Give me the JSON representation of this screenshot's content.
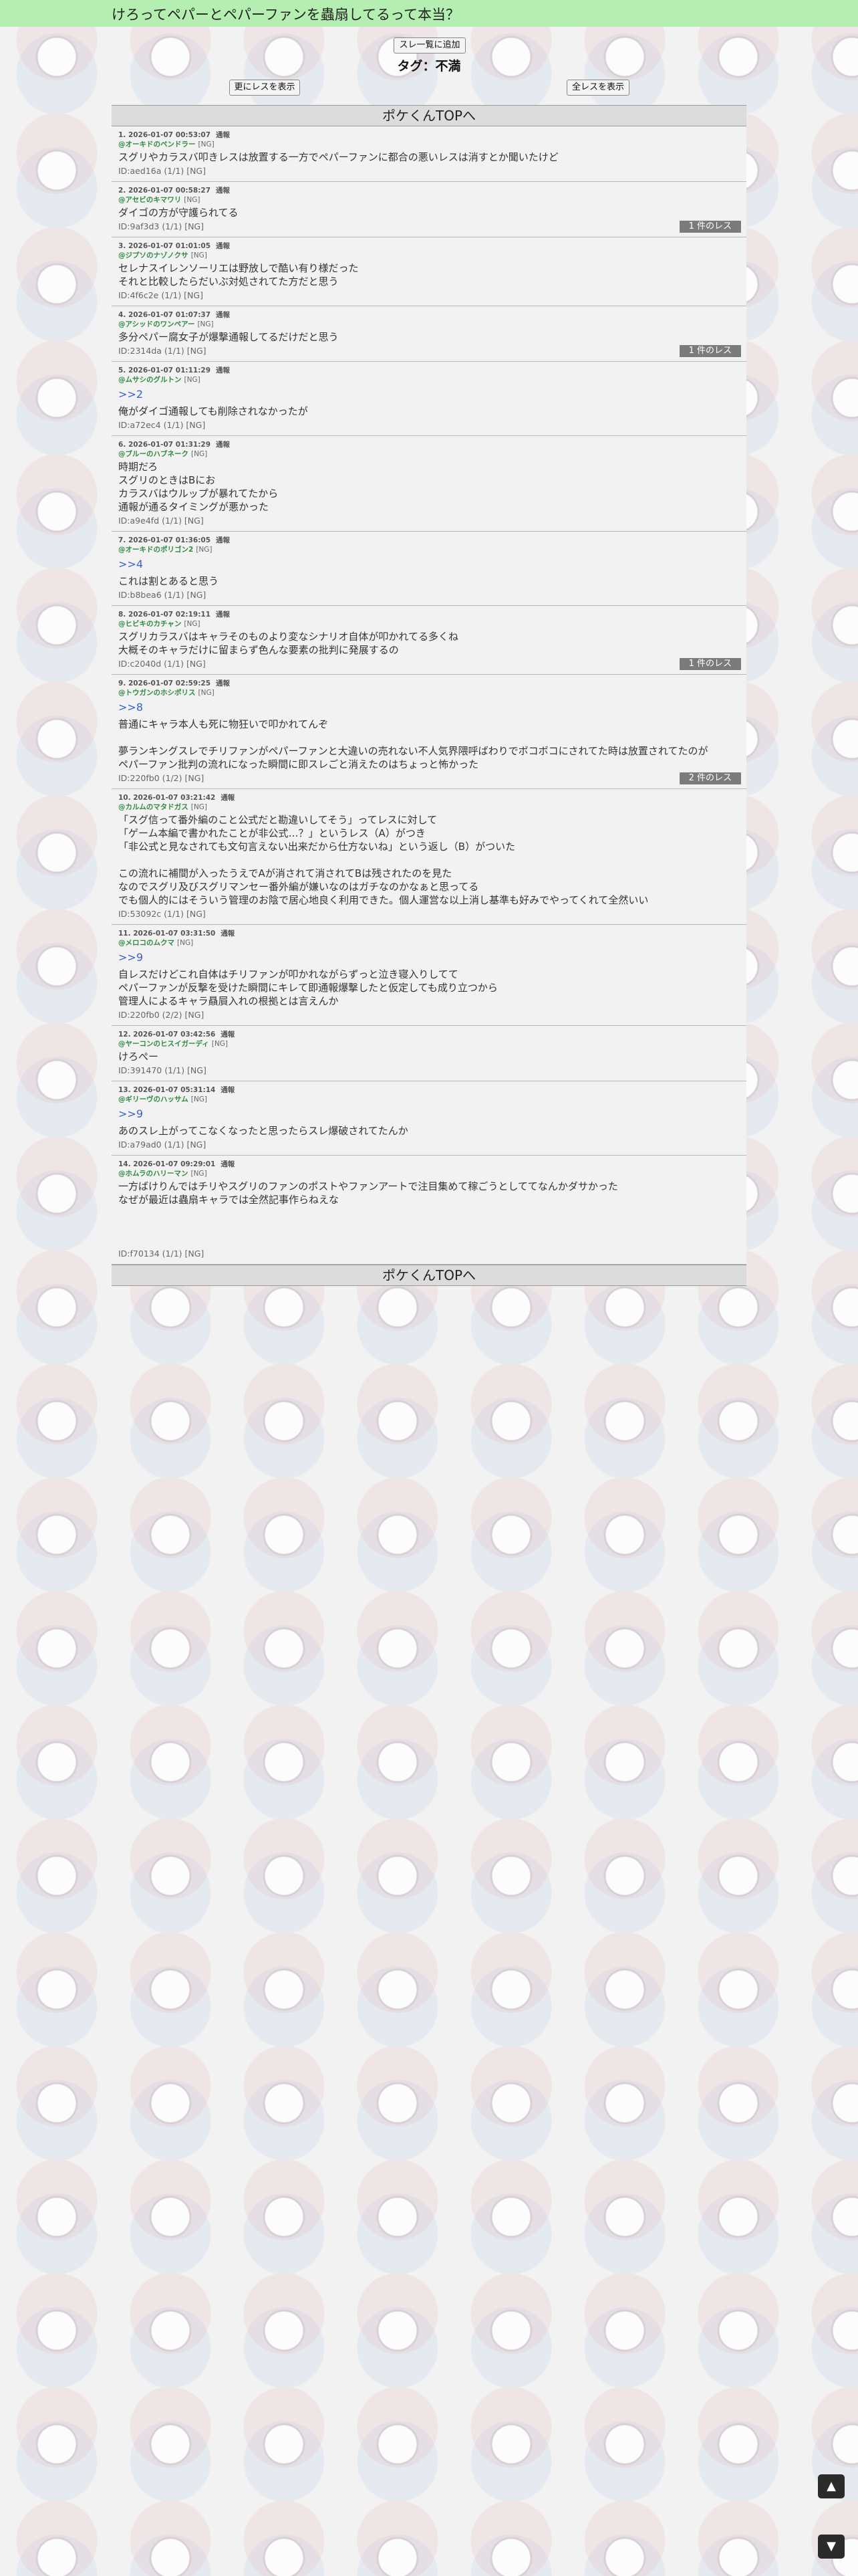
{
  "header": {
    "title": "けろってペパーとペパーファンを蟲扇してるって本当？"
  },
  "buttons": {
    "thread_list": "スレ一覧に追加",
    "prev": "更にレスを表示",
    "all": "全レスを表示"
  },
  "tag": "タグ：不満",
  "top_link": "ポケくんTOPへ",
  "posts": [
    {
      "meta": "1. 2026-01-07 00:53:07",
      "report": "通報",
      "name": "@オーキドのペンドラー",
      "ng": "[NG]",
      "anchor": "",
      "lines": [
        "スグリやカラスバ叩きレスは放置する一方でペパーファンに都合の悪いレスは消すとか聞いたけど"
      ],
      "id": "ID:aed16a (1/1) [NG]",
      "reply": ""
    },
    {
      "meta": "2. 2026-01-07 00:58:27",
      "report": "通報",
      "name": "@アセビのキマワリ",
      "ng": "[NG]",
      "anchor": "",
      "lines": [
        "ダイゴの方が守護られてる"
      ],
      "id": "ID:9af3d3 (1/1) [NG]",
      "reply": "1 件のレス"
    },
    {
      "meta": "3. 2026-01-07 01:01:05",
      "report": "通報",
      "name": "@ジプソのナゾノクサ",
      "ng": "[NG]",
      "anchor": "",
      "lines": [
        "セレナスイレンソーリエは野放しで酷い有り様だった",
        "それと比較したらだいぶ対処されてた方だと思う"
      ],
      "id": "ID:4f6c2e (1/1) [NG]",
      "reply": ""
    },
    {
      "meta": "4. 2026-01-07 01:07:37",
      "report": "通報",
      "name": "@アシッドのワンペアー",
      "ng": "[NG]",
      "anchor": "",
      "lines": [
        "多分ペパー腐女子が爆撃通報してるだけだと思う"
      ],
      "id": "ID:2314da (1/1) [NG]",
      "reply": "1 件のレス"
    },
    {
      "meta": "5. 2026-01-07 01:11:29",
      "report": "通報",
      "name": "@ムサシのグルトン",
      "ng": "[NG]",
      "anchor": ">>2",
      "lines": [
        "俺がダイゴ通報しても削除されなかったが"
      ],
      "id": "ID:a72ec4 (1/1) [NG]",
      "reply": ""
    },
    {
      "meta": "6. 2026-01-07 01:31:29",
      "report": "通報",
      "name": "@ブルーのハブネーク",
      "ng": "[NG]",
      "anchor": "",
      "lines": [
        "時期だろ",
        "スグリのときはBにお",
        "カラスバはウルップが暴れてたから",
        "通報が通るタイミングが悪かった"
      ],
      "id": "ID:a9e4fd (1/1) [NG]",
      "reply": ""
    },
    {
      "meta": "7. 2026-01-07 01:36:05",
      "report": "通報",
      "name": "@オーキドのポリゴン2",
      "ng": "[NG]",
      "anchor": ">>4",
      "lines": [
        "これは割とあると思う"
      ],
      "id": "ID:b8bea6 (1/1) [NG]",
      "reply": ""
    },
    {
      "meta": "8. 2026-01-07 02:19:11",
      "report": "通報",
      "name": "@ヒビキのカチャン",
      "ng": "[NG]",
      "anchor": "",
      "lines": [
        "スグリカラスバはキャラそのものより変なシナリオ自体が叩かれてる多くね",
        "大概そのキャラだけに留まらず色んな要素の批判に発展するの"
      ],
      "id": "ID:c2040d (1/1) [NG]",
      "reply": "1 件のレス"
    },
    {
      "meta": "9. 2026-01-07 02:59:25",
      "report": "通報",
      "name": "@トウガンのホシポリス",
      "ng": "[NG]",
      "anchor": ">>8",
      "lines": [
        "普通にキャラ本人も死に物狂いで叩かれてんぞ",
        "",
        "夢ランキングスレでチリファンがペパーファンと大違いの売れない不人気界隈呼ばわりでボコボコにされてた時は放置されてたのが",
        "ペパーファン批判の流れになった瞬間に即スレごと消えたのはちょっと怖かった"
      ],
      "id": "ID:220fb0 (1/2) [NG]",
      "reply": "2 件のレス"
    },
    {
      "meta": "10. 2026-01-07 03:21:42",
      "report": "通報",
      "name": "@カルムのマタドガス",
      "ng": "[NG]",
      "anchor": "",
      "lines": [
        "「スグ信って番外編のこと公式だと勘違いしてそう」ってレスに対して",
        "「ゲーム本編で書かれたことが非公式…？」というレス（A）がつき",
        "「非公式と見なされても文句言えない出来だから仕方ないね」という返し（B）がついた",
        "",
        "この流れに補間が入ったうえでAが消されて消されてBは残されたのを見た",
        "なのでスグリ及びスグリマンセー番外編が嫌いなのはガチなのかなぁと思ってる",
        "でも個人的にはそういう管理のお陰で居心地良く利用できた。個人運営な以上消し基準も好みでやってくれて全然いい"
      ],
      "id": "ID:53092c (1/1) [NG]",
      "reply": ""
    },
    {
      "meta": "11. 2026-01-07 03:31:50",
      "report": "通報",
      "name": "@メロコのムクマ",
      "ng": "[NG]",
      "anchor": ">>9",
      "lines": [
        "自レスだけどこれ自体はチリファンが叩かれながらずっと泣き寝入りしてて",
        "ペパーファンが反撃を受けた瞬間にキレて即通報爆撃したと仮定しても成り立つから",
        "管理人によるキャラ贔屓入れの根拠とは言えんか"
      ],
      "id": "ID:220fb0 (2/2) [NG]",
      "reply": ""
    },
    {
      "meta": "12. 2026-01-07 03:42:56",
      "report": "通報",
      "name": "@ヤーコンのヒスイガーディ",
      "ng": "[NG]",
      "anchor": "",
      "lines": [
        "けろぺー"
      ],
      "id": "ID:391470 (1/1) [NG]",
      "reply": ""
    },
    {
      "meta": "13. 2026-01-07 05:31:14",
      "report": "通報",
      "name": "@ギリーヴのハッサム",
      "ng": "[NG]",
      "anchor": ">>9",
      "lines": [
        "あのスレ上がってこなくなったと思ったらスレ爆破されてたんか"
      ],
      "id": "ID:a79ad0 (1/1) [NG]",
      "reply": ""
    },
    {
      "meta": "14. 2026-01-07 09:29:01",
      "report": "通報",
      "name": "@ホムラのハリーマン",
      "ng": "[NG]",
      "anchor": "",
      "lines": [
        "一方ばけりんではチリやスグリのファンのポストやファンアートで注目集めて稼ごうとしててなんかダサかった",
        "なぜが最近は蟲扇キャラでは全然記事作らねえな",
        "",
        "",
        ""
      ],
      "id": "ID:f70134 (1/1) [NG]",
      "reply": ""
    }
  ],
  "scroll": {
    "up": "▲",
    "down": "▼"
  }
}
